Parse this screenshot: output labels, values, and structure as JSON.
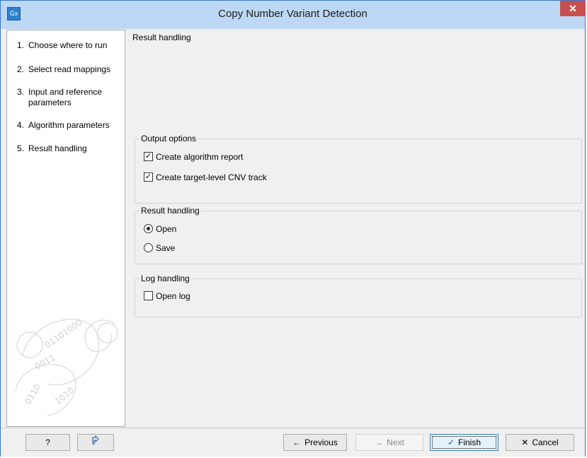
{
  "window": {
    "title": "Copy Number Variant Detection",
    "app_icon_text": "Gx",
    "close_glyph": "✕"
  },
  "steps": [
    {
      "number": "1.",
      "label": "Choose where to run"
    },
    {
      "number": "2.",
      "label": "Select read mappings"
    },
    {
      "number": "3.",
      "label": "Input and reference parameters"
    },
    {
      "number": "4.",
      "label": "Algorithm parameters"
    },
    {
      "number": "5.",
      "label": "Result handling"
    }
  ],
  "content": {
    "section_title": "Result handling",
    "output_options": {
      "title": "Output options",
      "create_report": {
        "label": "Create algorithm report",
        "checked": true
      },
      "create_track": {
        "label": "Create target-level CNV track",
        "checked": true
      }
    },
    "result_handling": {
      "title": "Result handling",
      "open": {
        "label": "Open",
        "selected": true
      },
      "save": {
        "label": "Save",
        "selected": false
      }
    },
    "log_handling": {
      "title": "Log handling",
      "open_log": {
        "label": "Open log",
        "checked": false
      }
    }
  },
  "buttons": {
    "help": "?",
    "previous": "Previous",
    "next": "Next",
    "finish": "Finish",
    "cancel": "Cancel"
  },
  "icons": {
    "help": "question-icon",
    "reset": "reset-icon",
    "previous": "arrow-left-icon",
    "next": "arrow-right-icon",
    "finish": "checkmark-icon",
    "cancel": "x-icon"
  },
  "colors": {
    "titlebar": "#bcd8f5",
    "close_button": "#c75050",
    "primary_button": "#e5f1fb"
  }
}
